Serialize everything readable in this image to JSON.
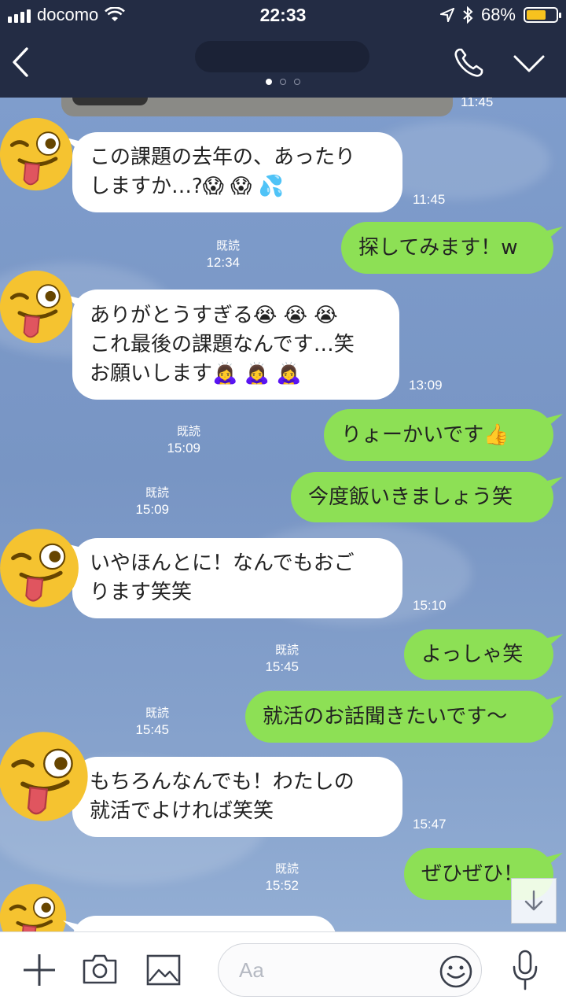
{
  "status_bar": {
    "carrier": "docomo",
    "time": "22:33",
    "battery_percent": "68%",
    "battery_level": 0.68
  },
  "header": {
    "page_indicator": {
      "count": 3,
      "active": 0
    }
  },
  "chat": {
    "messages": [
      {
        "side": "in",
        "lines": [
          "この課題の去年の、あったり",
          "しますか…?😱 😱 💦"
        ],
        "time": "11:45"
      },
      {
        "side": "out",
        "lines": [
          "探してみます！w"
        ],
        "read": "既読",
        "time": "12:34"
      },
      {
        "side": "in",
        "lines": [
          "ありがとうすぎる😭 😭 😭",
          "これ最後の課題なんです…笑",
          "お願いします🙇‍♀️ 🙇‍♀️ 🙇‍♀️"
        ],
        "time": "13:09"
      },
      {
        "side": "out",
        "lines": [
          "りょーかいです👍"
        ],
        "read": "既読",
        "time": "15:09"
      },
      {
        "side": "out",
        "lines": [
          "今度飯いきましょう笑"
        ],
        "read": "既読",
        "time": "15:09"
      },
      {
        "side": "in",
        "lines": [
          "いやほんとに！なんでもおご",
          "ります笑笑"
        ],
        "time": "15:10"
      },
      {
        "side": "out",
        "lines": [
          "よっしゃ笑"
        ],
        "read": "既読",
        "time": "15:45"
      },
      {
        "side": "out",
        "lines": [
          "就活のお話聞きたいです〜"
        ],
        "read": "既読",
        "time": "15:45"
      },
      {
        "side": "in",
        "lines": [
          "もちろんなんでも！わたしの",
          "就活でよければ笑笑"
        ],
        "time": "15:47"
      },
      {
        "side": "out",
        "lines": [
          "ぜひぜひ！"
        ],
        "read": "既読",
        "time": "15:52"
      }
    ],
    "previous_time": "11:45"
  },
  "input": {
    "placeholder": "Aa"
  },
  "colors": {
    "header_bg": "#232c44",
    "chat_bg": "#7c9bc8",
    "out_bubble": "#8de055",
    "in_bubble": "#ffffff",
    "battery": "#f7c21e"
  },
  "icons": [
    "signal-icon",
    "wifi-icon",
    "location-icon",
    "bluetooth-icon",
    "battery-icon",
    "back-icon",
    "phone-icon",
    "chevron-down-icon",
    "plus-icon",
    "camera-icon",
    "image-icon",
    "emoji-icon",
    "mic-icon",
    "arrow-down-icon"
  ]
}
